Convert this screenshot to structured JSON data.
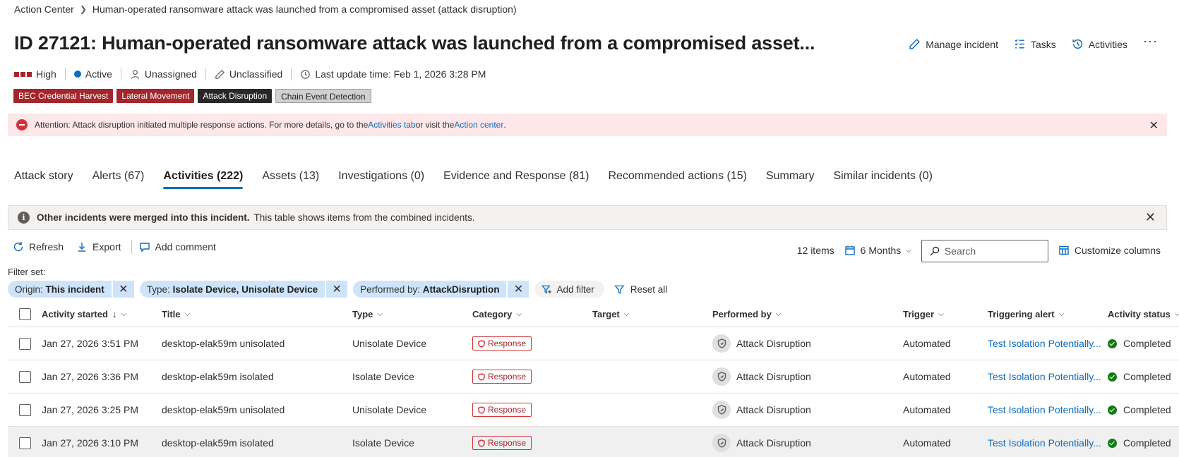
{
  "breadcrumb": {
    "root": "Action Center",
    "current": "Human-operated ransomware attack was launched from a compromised asset (attack disruption)"
  },
  "title": "ID 27121: Human-operated ransomware attack was launched from a compromised asset...",
  "header_actions": {
    "manage": "Manage incident",
    "tasks": "Tasks",
    "activities": "Activities",
    "more": "···"
  },
  "meta": {
    "severity": "High",
    "status": "Active",
    "assigned": "Unassigned",
    "classification": "Unclassified",
    "last_update": "Last update time: Feb 1, 2026 3:28 PM"
  },
  "tags": [
    "BEC Credential Harvest",
    "Lateral Movement",
    "Attack Disruption",
    "Chain Event Detection"
  ],
  "attention": {
    "prefix": "Attention: Attack disruption initiated multiple response actions. For more details, go to the ",
    "link1": "Activities tab",
    "middle": " or visit the ",
    "link2": "Action center",
    "suffix": "."
  },
  "tabs": [
    "Attack story",
    "Alerts (67)",
    "Activities (222)",
    "Assets (13)",
    "Investigations (0)",
    "Evidence and Response (81)",
    "Recommended actions (15)",
    "Summary",
    "Similar incidents (0)"
  ],
  "active_tab": "Activities (222)",
  "merged": {
    "bold": "Other incidents were merged into this incident.",
    "text": "This table shows items from the combined incidents."
  },
  "toolbar": {
    "refresh": "Refresh",
    "export": "Export",
    "add_comment": "Add comment",
    "items": "12 items",
    "range": "6 Months",
    "search_placeholder": "Search",
    "customize": "Customize columns"
  },
  "filter_label": "Filter set:",
  "filters": [
    {
      "key": "Origin: ",
      "value": "This incident"
    },
    {
      "key": "Type: ",
      "value": "Isolate Device, Unisolate Device"
    },
    {
      "key": "Performed by: ",
      "value": "AttackDisruption"
    }
  ],
  "filter_actions": {
    "add": "Add filter",
    "reset": "Reset all"
  },
  "columns": {
    "started": "Activity started",
    "title": "Title",
    "type": "Type",
    "category": "Category",
    "target": "Target",
    "performed_by": "Performed by",
    "trigger": "Trigger",
    "alert": "Triggering alert",
    "status": "Activity status"
  },
  "rows": [
    {
      "started": "Jan 27, 2026 3:51 PM",
      "title": "desktop-elak59m unisolated",
      "type": "Unisolate Device",
      "category": "Response",
      "target": "",
      "performed_by": "Attack Disruption",
      "trigger": "Automated",
      "alert": "Test Isolation Potentially...",
      "status": "Completed"
    },
    {
      "started": "Jan 27, 2026 3:36 PM",
      "title": "desktop-elak59m isolated",
      "type": "Isolate Device",
      "category": "Response",
      "target": "",
      "performed_by": "Attack Disruption",
      "trigger": "Automated",
      "alert": "Test Isolation Potentially...",
      "status": "Completed"
    },
    {
      "started": "Jan 27, 2026 3:25 PM",
      "title": "desktop-elak59m unisolated",
      "type": "Unisolate Device",
      "category": "Response",
      "target": "",
      "performed_by": "Attack Disruption",
      "trigger": "Automated",
      "alert": "Test Isolation Potentially...",
      "status": "Completed"
    },
    {
      "started": "Jan 27, 2026 3:10 PM",
      "title": "desktop-elak59m isolated",
      "type": "Isolate Device",
      "category": "Response",
      "target": "",
      "performed_by": "Attack Disruption",
      "trigger": "Automated",
      "alert": "Test Isolation Potentially...",
      "status": "Completed"
    }
  ],
  "colors": {
    "accent": "#0f6cbd",
    "severity": "#a4262c",
    "attention_bg": "#fde7e9",
    "success": "#107c10"
  }
}
